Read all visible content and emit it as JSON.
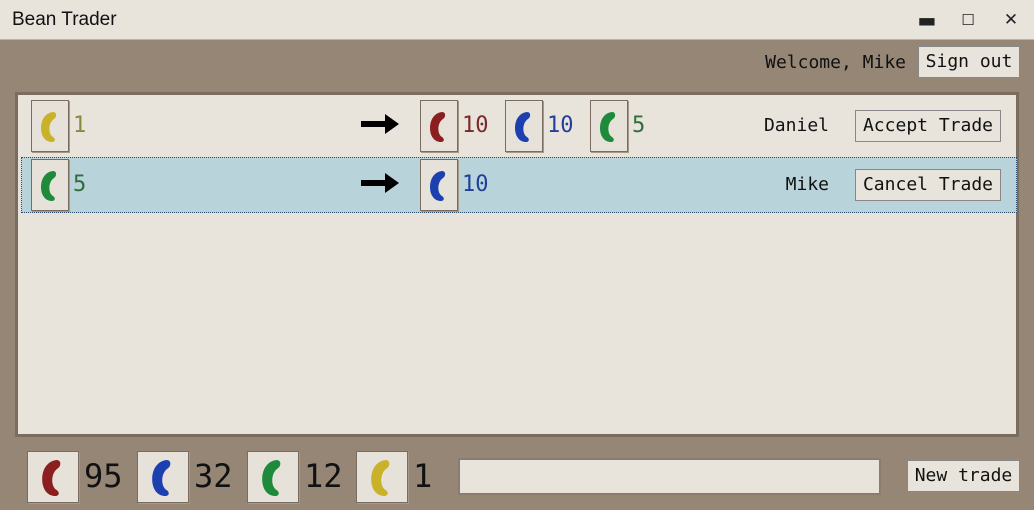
{
  "window": {
    "title": "Bean Trader"
  },
  "header": {
    "welcome": "Welcome, Mike",
    "sign_out_label": "Sign out"
  },
  "colors": {
    "red": "#8b1e1e",
    "blue": "#1c40b0",
    "green": "#1f8a3a",
    "yellow": "#c9b22a"
  },
  "trades": [
    {
      "offer": [
        {
          "bean": "yellow",
          "qty": "1"
        }
      ],
      "request": [
        {
          "bean": "red",
          "qty": "10"
        },
        {
          "bean": "blue",
          "qty": "10"
        },
        {
          "bean": "green",
          "qty": "5"
        }
      ],
      "trader": "Daniel",
      "action_label": "Accept Trade",
      "selected": false
    },
    {
      "offer": [
        {
          "bean": "green",
          "qty": "5"
        }
      ],
      "request": [
        {
          "bean": "blue",
          "qty": "10"
        }
      ],
      "trader": "Mike",
      "action_label": "Cancel Trade",
      "selected": true
    }
  ],
  "inventory": [
    {
      "bean": "red",
      "qty": "95"
    },
    {
      "bean": "blue",
      "qty": "32"
    },
    {
      "bean": "green",
      "qty": "12"
    },
    {
      "bean": "yellow",
      "qty": "1"
    }
  ],
  "new_trade": {
    "input_value": "",
    "button_label": "New trade"
  },
  "icons": {
    "arrow": "right-arrow-icon",
    "bean": "bean-icon"
  }
}
